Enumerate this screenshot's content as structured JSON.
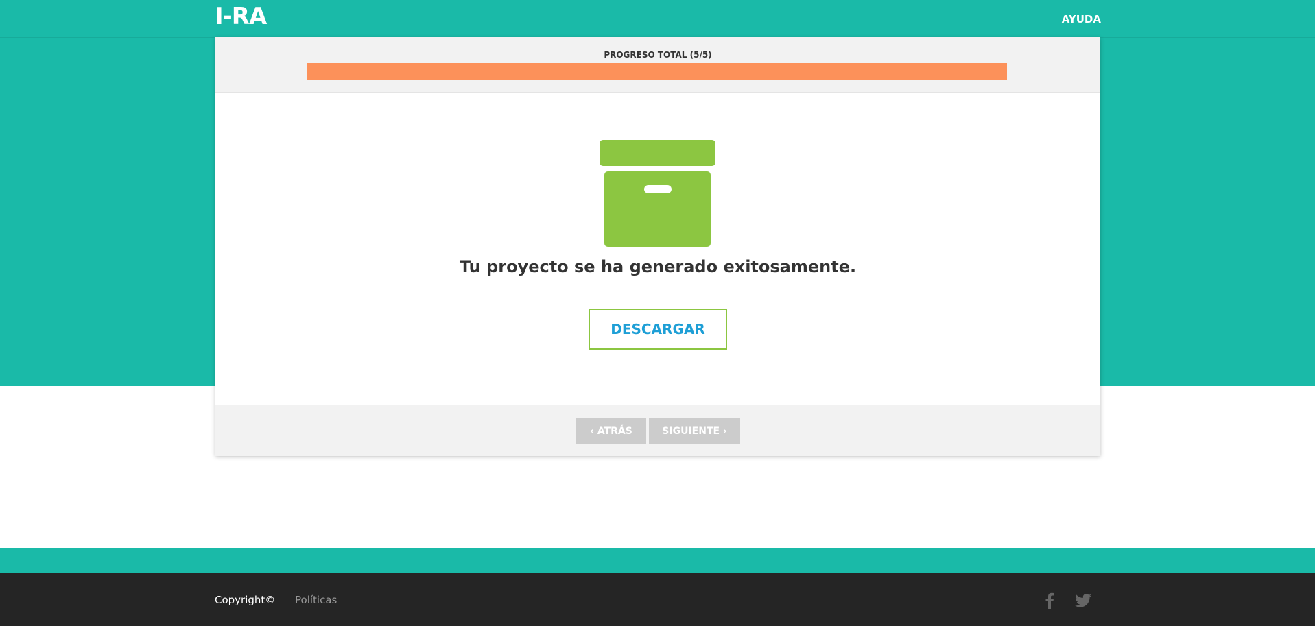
{
  "header": {
    "logo": "I-RA",
    "help_link": "AYUDA"
  },
  "progress": {
    "label": "PROGRESO TOTAL (5/5)",
    "completed": 5,
    "total": 5,
    "fraction": 1.0,
    "fill_color": "#fc915a"
  },
  "main": {
    "icon": "archive-box-icon",
    "message": "Tu proyecto se ha generado exitosamente.",
    "download_label": "DESCARGAR"
  },
  "navigation": {
    "back_label": "‹ ATRÁS",
    "next_label": "SIGUIENTE ›"
  },
  "footer": {
    "copyright": "Copyright©",
    "policies_link": "Políticas",
    "social": [
      "facebook-icon",
      "twitter-icon"
    ]
  },
  "colors": {
    "brand_teal": "#1abaa8",
    "accent_green": "#8cc641",
    "link_blue": "#1e9fd6",
    "footer_dark": "#252525"
  }
}
